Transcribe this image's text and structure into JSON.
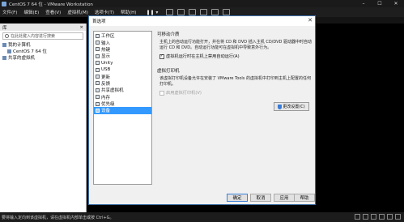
{
  "window": {
    "title": "CentOS 7 64 位 - VMware Workstation"
  },
  "menu": {
    "items": [
      "文件(F)",
      "编辑(E)",
      "查看(V)",
      "虚拟机(M)",
      "选项卡(T)",
      "帮助(H)"
    ],
    "pause_symbol": "❚❚ ▾"
  },
  "library": {
    "title": "库",
    "close_symbol": "×",
    "search_placeholder": "在此处键入内容进行搜索",
    "tree": [
      {
        "label": "我的计算机"
      },
      {
        "label": "CentOS 7 64 位"
      },
      {
        "label": "共享的虚拟机"
      }
    ]
  },
  "status": {
    "text": "要将输入定向到该虚拟机，请在虚拟机内部单击或按 Ctrl+G。"
  },
  "dialog": {
    "title": "首选项",
    "nav_items": [
      {
        "label": "工作区"
      },
      {
        "label": "输入"
      },
      {
        "label": "热键"
      },
      {
        "label": "显示"
      },
      {
        "label": "Unity"
      },
      {
        "label": "USB"
      },
      {
        "label": "更新"
      },
      {
        "label": "反馈"
      },
      {
        "label": "共享虚拟机"
      },
      {
        "label": "内存"
      },
      {
        "label": "优先级"
      },
      {
        "label": "设备",
        "selected": true
      }
    ],
    "removable": {
      "title": "可移动介质",
      "desc": "主机上的自动运行功能打开，并在将 CD 和 DVD 插入主机 CD/DVD 驱动器中时自动运行 CD 和 DVD。自动运行功能可在虚拟机中导致意外行为。",
      "checkbox_label": "虚拟机运行时在主机上禁用自动运行(A)",
      "checked": true
    },
    "printer": {
      "title": "虚拟打印机",
      "desc": "该虚拟打印机设备允许在安装了 VMware Tools 的虚拟机中打印到主机上配置的任何打印机。",
      "checkbox_label": "启用虚拟打印机(V)",
      "checked": false,
      "settings_button": "更改设置(C)"
    },
    "buttons": {
      "ok": "确定",
      "cancel": "取消",
      "apply": "应用",
      "help": "帮助"
    }
  }
}
